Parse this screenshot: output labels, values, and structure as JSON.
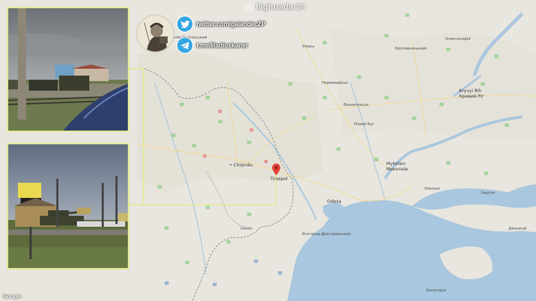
{
  "brand": {
    "name": "flightradar24",
    "icon": "radar-icon"
  },
  "social": [
    {
      "icon": "twitter-bird-icon",
      "text": "twitter.com/galandecZP"
    },
    {
      "icon": "telegram-plane-icon",
      "text": "t.me/Radioskaner"
    }
  ],
  "map": {
    "cities": [
      {
        "name": "Chișinău",
        "icon": "city-dot-icon"
      },
      {
        "name": "Tiraspol",
        "icon": "map-pin-icon"
      },
      {
        "name": "Odesa",
        "icon": "city-dot-icon"
      },
      {
        "name": "Mykolaiv Миколаїв",
        "icon": "city-dot-icon"
      },
      {
        "name": "Kryvyi Rih Кривий Ріг",
        "icon": "city-dot-icon"
      }
    ],
    "pin_color": "#e5423a",
    "water_color": "#a9c7de",
    "land_color": "#e8e6df"
  },
  "attribution": "Google",
  "photos": [
    {
      "description_name": "photo-military-trucks-rail"
    },
    {
      "description_name": "photo-tank-checkpoint"
    }
  ]
}
